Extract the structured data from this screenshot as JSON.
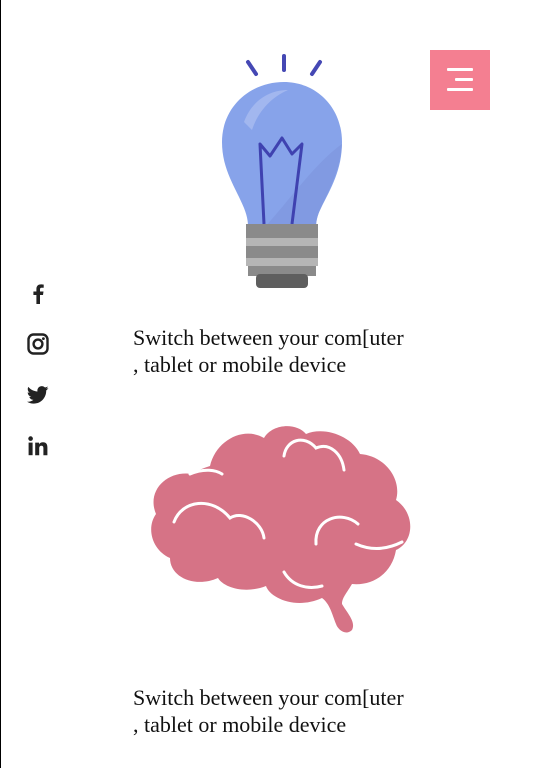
{
  "menu": {
    "icon": "hamburger-menu-icon",
    "color": "#f47f91"
  },
  "social": [
    {
      "icon": "facebook-icon"
    },
    {
      "icon": "instagram-icon"
    },
    {
      "icon": "twitter-icon"
    },
    {
      "icon": "linkedin-icon"
    }
  ],
  "features": [
    {
      "illustration": "lightbulb-icon",
      "caption": "Switch between your com[uter\n, tablet or mobile device"
    },
    {
      "illustration": "brain-icon",
      "caption": "Switch between your com[uter\n, tablet or mobile device"
    }
  ],
  "colors": {
    "bulb": "#87a3ea",
    "brain": "#d67386",
    "accent": "#f47f91"
  }
}
